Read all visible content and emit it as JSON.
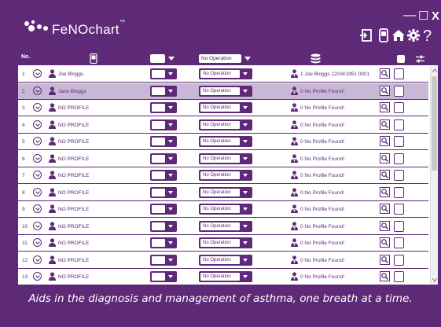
{
  "app": {
    "brand": "FeNOchart",
    "trademark": "™"
  },
  "window_controls": {
    "minimize": "—",
    "maximize": "☐",
    "close": "X"
  },
  "toolbar": {
    "icons": [
      "export-icon",
      "device-icon",
      "home-icon",
      "settings-icon",
      "help-icon"
    ],
    "help_label": "?"
  },
  "grid": {
    "header": {
      "no_label": "No.",
      "operation_default": "No Operation"
    },
    "rows": [
      {
        "num": "1",
        "name": "Joe Bloggs",
        "operation": "No Operation",
        "profile": "1 Joe Bloggs 12/04/1951 0001",
        "selected": false
      },
      {
        "num": "2",
        "name": "Jane Bloggs",
        "operation": "No Operation",
        "profile": "0 No Profile Found!",
        "selected": true
      },
      {
        "num": "3",
        "name": "NO PROFILE",
        "operation": "No Operation",
        "profile": "0 No Profile Found!",
        "selected": false
      },
      {
        "num": "4",
        "name": "NO PROFILE",
        "operation": "No Operation",
        "profile": "0 No Profile Found!",
        "selected": false
      },
      {
        "num": "5",
        "name": "NO PROFILE",
        "operation": "No Operation",
        "profile": "0 No Profile Found!",
        "selected": false
      },
      {
        "num": "6",
        "name": "NO PROFILE",
        "operation": "No Operation",
        "profile": "0 No Profile Found!",
        "selected": false
      },
      {
        "num": "7",
        "name": "NO PROFILE",
        "operation": "No Operation",
        "profile": "0 No Profile Found!",
        "selected": false
      },
      {
        "num": "8",
        "name": "NO PROFILE",
        "operation": "No Operation",
        "profile": "0 No Profile Found!",
        "selected": false
      },
      {
        "num": "9",
        "name": "NO PROFILE",
        "operation": "No Operation",
        "profile": "0 No Profile Found!",
        "selected": false
      },
      {
        "num": "10",
        "name": "NO PROFILE",
        "operation": "No Operation",
        "profile": "0 No Profile Found!",
        "selected": false
      },
      {
        "num": "11",
        "name": "NO PROFILE",
        "operation": "No Operation",
        "profile": "0 No Profile Found!",
        "selected": false
      },
      {
        "num": "12",
        "name": "NO PROFILE",
        "operation": "No Operation",
        "profile": "0 No Profile Found!",
        "selected": false
      },
      {
        "num": "13",
        "name": "NO PROFILE",
        "operation": "No Operation",
        "profile": "0 No Profile Found!",
        "selected": false
      }
    ]
  },
  "footer": {
    "tagline": "Aids in the diagnosis and management of asthma, one breath at a time."
  },
  "colors": {
    "brand": "#5e2a78",
    "selected_row": "#c9b8d5"
  }
}
